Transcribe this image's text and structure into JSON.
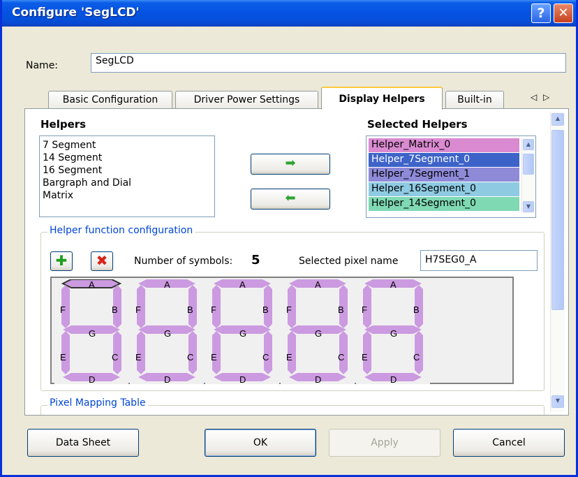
{
  "window": {
    "title": "Configure 'SegLCD'",
    "help_glyph": "?",
    "close_glyph": "✕"
  },
  "name_field": {
    "label": "Name:",
    "value": "SegLCD"
  },
  "tabs": [
    {
      "label": "Basic Configuration",
      "active": false
    },
    {
      "label": "Driver Power Settings",
      "active": false
    },
    {
      "label": "Display Helpers",
      "active": true
    },
    {
      "label": "Built-in",
      "active": false
    }
  ],
  "tab_scroll": {
    "left": "◁",
    "right": "▷"
  },
  "helpers": {
    "title": "Helpers",
    "items": [
      "7 Segment",
      "14 Segment",
      "16 Segment",
      "Bargraph and Dial",
      "Matrix"
    ]
  },
  "selected_helpers": {
    "title": "Selected Helpers",
    "items": [
      {
        "label": "Helper_Matrix_0",
        "color": "#d98ad0",
        "text_color": "#000000"
      },
      {
        "label": "Helper_7Segment_0",
        "color": "#3d63c9",
        "text_color": "#ffffff"
      },
      {
        "label": "Helper_7Segment_1",
        "color": "#8e8ad8",
        "text_color": "#000000"
      },
      {
        "label": "Helper_16Segment_0",
        "color": "#8ecbe3",
        "text_color": "#000000"
      },
      {
        "label": "Helper_14Segment_0",
        "color": "#7fd9b3",
        "text_color": "#000000"
      }
    ]
  },
  "arrows": {
    "add": "➡",
    "remove": "⬅",
    "arrow_color": "#2ea32e"
  },
  "helper_config": {
    "title": "Helper function configuration",
    "add_icon": "✚",
    "delete_icon": "✖",
    "num_symbols_label": "Number of symbols:",
    "num_symbols_value": "5",
    "pixel_name_label": "Selected pixel name",
    "pixel_name_value": "H7SEG0_A"
  },
  "segments": {
    "labels": {
      "a": "A",
      "b": "B",
      "c": "C",
      "d": "D",
      "e": "E",
      "f": "F",
      "g": "G"
    },
    "count": 5,
    "segment_color": "#cb9ae0",
    "selected_segment": "A"
  },
  "pixel_mapping": {
    "title": "Pixel Mapping Table"
  },
  "footer": {
    "datasheet": "Data Sheet",
    "ok": "OK",
    "apply": "Apply",
    "cancel": "Cancel"
  }
}
